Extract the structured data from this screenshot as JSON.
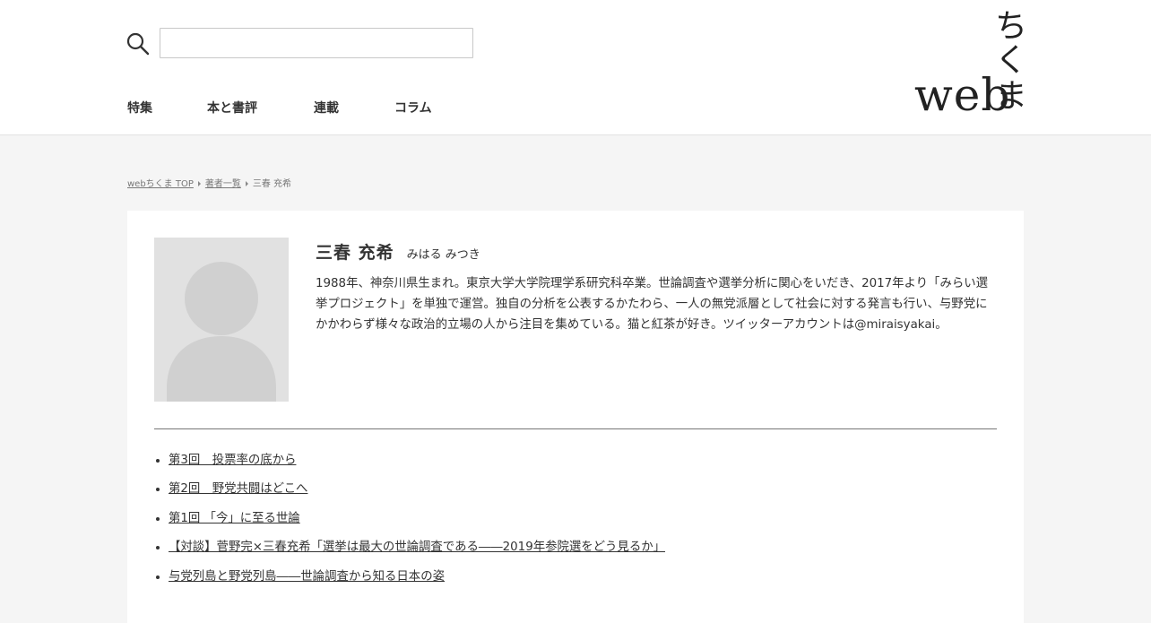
{
  "header": {
    "search": {
      "placeholder": "",
      "value": ""
    },
    "nav": [
      {
        "label": "特集"
      },
      {
        "label": "本と書評"
      },
      {
        "label": "連載"
      },
      {
        "label": "コラム"
      }
    ],
    "logo": {
      "line1": "ち",
      "line2": "く",
      "web": "web",
      "ma": "ま"
    }
  },
  "breadcrumb": {
    "items": [
      "webちくま TOP",
      "著者一覧",
      "三春 充希"
    ]
  },
  "author": {
    "name": "三春 充希",
    "kana": "みはる みつき",
    "bio": "1988年、神奈川県生まれ。東京大学大学院理学系研究科卒業。世論調査や選挙分析に関心をいだき、2017年より「みらい選挙プロジェクト」を単独で運営。独自の分析を公表するかたわら、一人の無党派層として社会に対する発言も行い、与野党にかかわらず様々な政治的立場の人から注目を集めている。猫と紅茶が好き。ツイッターアカウントは@miraisyakai。"
  },
  "articles": [
    "第3回　投票率の底から",
    "第2回　野党共闘はどこへ",
    "第1回 「今」に至る世論",
    "【対談】菅野完×三春充希「選挙は最大の世論調査である――2019年参院選をどう見るか」",
    "与党列島と野党列島――世論調査から知る日本の姿"
  ]
}
